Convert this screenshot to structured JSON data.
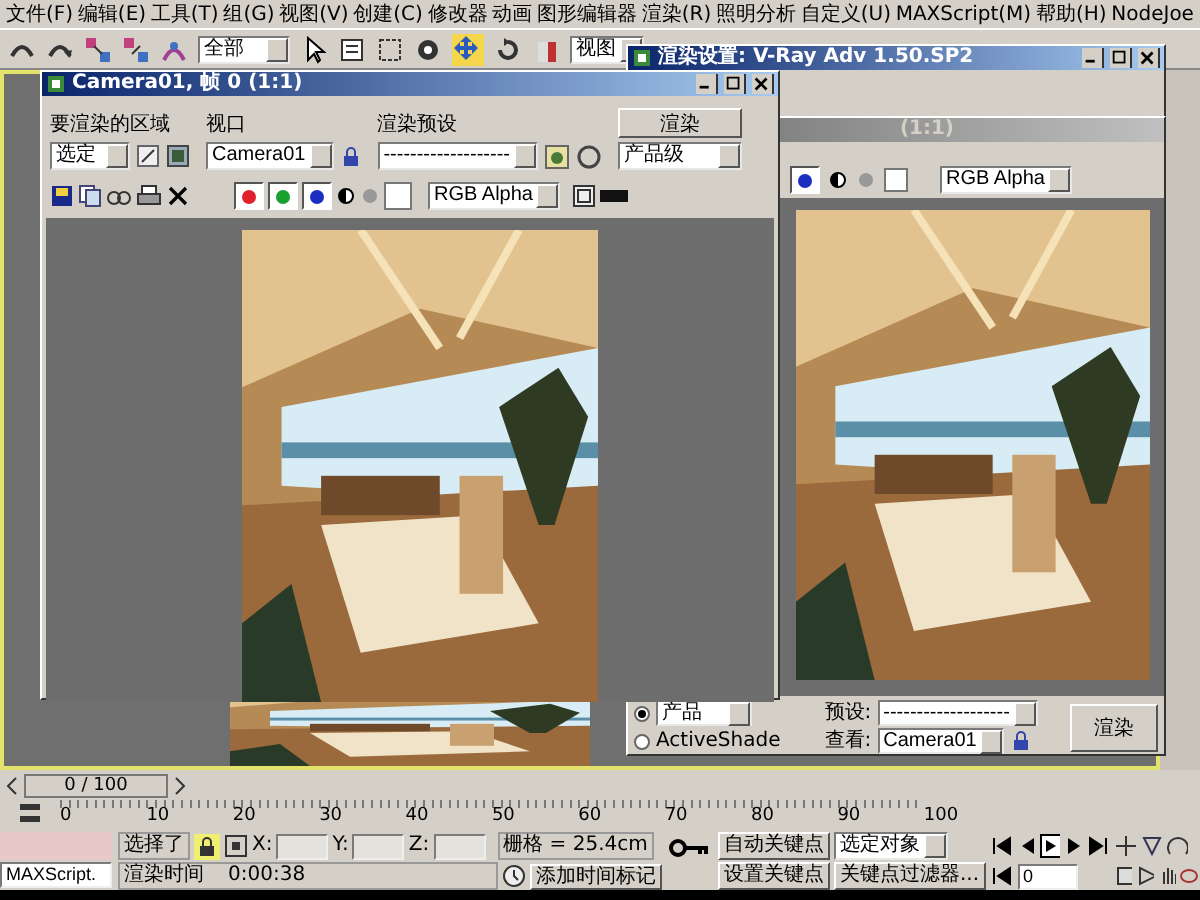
{
  "menu": [
    "文件(F)",
    "编辑(E)",
    "工具(T)",
    "组(G)",
    "视图(V)",
    "创建(C)",
    "修改器",
    "动画",
    "图形编辑器",
    "渲染(R)",
    "照明分析",
    "自定义(U)",
    "MAXScript(M)",
    "帮助(H)",
    "NodeJoe"
  ],
  "toolbar": {
    "selection_filter": "全部",
    "coordinate_system": "视图",
    "move_selected": true
  },
  "render_setup": {
    "title": "渲染设置: V-Ray Adv 1.50.SP2",
    "modes": [
      {
        "kind": "dropdown",
        "label": "产品",
        "selected": true
      },
      {
        "kind": "label",
        "label": "ActiveShade",
        "selected": false
      }
    ],
    "preset_label": "预设:",
    "preset_value": "-------------------",
    "view_label": "查看:",
    "view_value": "Camera01",
    "render_button": "渲染"
  },
  "back_frame_window": {
    "title": "(1:1)",
    "channels": [
      {
        "color": "#1a2ec0",
        "on": true
      }
    ],
    "channel_display": "RGB Alpha"
  },
  "frame_window": {
    "title": "Camera01, 帧 0 (1:1)",
    "area_label": "要渲染的区域",
    "area_value": "选定",
    "viewport_label": "视口",
    "viewport_value": "Camera01",
    "preset_label": "渲染预设",
    "preset_value": "-------------------",
    "render_button": "渲染",
    "render_mode": "产品级",
    "channels": [
      {
        "color": "#e0202a",
        "on": true
      },
      {
        "color": "#18a030",
        "on": true
      },
      {
        "color": "#1a2ec0",
        "on": true
      }
    ],
    "channel_display": "RGB Alpha"
  },
  "timeline": {
    "position": "0 / 100",
    "ticks": [
      "0",
      "10",
      "20",
      "30",
      "40",
      "50",
      "60",
      "70",
      "80",
      "90",
      "100"
    ]
  },
  "status": {
    "script_field": "MAXScript.",
    "selection": "选择了",
    "selection_lock": true,
    "x_label": "X:",
    "y_label": "Y:",
    "z_label": "Z:",
    "grid": "栅格 = 25.4cm",
    "render_time_label": "渲染时间",
    "render_time": "0:00:38",
    "add_time_tag": "添加时间标记",
    "auto_key": "自动关键点",
    "set_key": "设置关键点",
    "key_target": "选定对象",
    "key_filters": "关键点过滤器...",
    "frame": "0"
  }
}
